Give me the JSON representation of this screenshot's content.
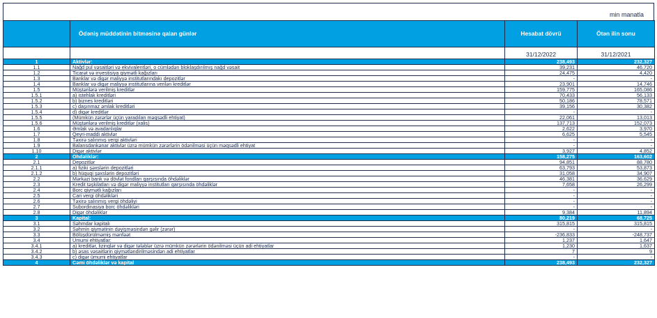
{
  "units": "min manatla",
  "header": {
    "name_col": "Ödəniş müddətinin bitməsinə qalan günlər",
    "current_col": "Hesabat dövrü",
    "previous_col": "Ötən ilin sonu",
    "current_date": "31/12/2022",
    "previous_date": "31/12/2021"
  },
  "rows": [
    {
      "num": "1",
      "name": "Aktivlər:",
      "cur": "238,493",
      "prev": "232,327",
      "section": true
    },
    {
      "num": "1.1",
      "name": "Nağd pul vəsaitləri və  ekvivalentləri, o cümlədən bloklaşdırılmış nağd vəsait",
      "cur": "39,231",
      "prev": "46,720"
    },
    {
      "num": "1.2",
      "name": "Ticarət və investisiya qiymətli kağızları",
      "cur": "24,475",
      "prev": "4,420"
    },
    {
      "num": "1.3",
      "name": "Banklar və digər maliyyə institutlarındakı depozitlər",
      "cur": "-",
      "prev": "-"
    },
    {
      "num": "1.4",
      "name": "Banklar və digər maliyyə institutlarına verilən kreditlər",
      "cur": "23,901",
      "prev": "14,746"
    },
    {
      "num": "1.5",
      "name": "Müştərilərə verilmiş kreditlər",
      "cur": "159,775",
      "prev": "165,086"
    },
    {
      "num": "1.5.1",
      "name": "a) istehlak kreditləri",
      "cur": "70,433",
      "prev": "56,133"
    },
    {
      "num": "1.5.2",
      "name": "b) biznes kreditləri",
      "cur": "50,186",
      "prev": "78,571"
    },
    {
      "num": "1.5.3",
      "name": "c) daşınmaz əmlak kreditləri",
      "cur": "39,156",
      "prev": "30,382"
    },
    {
      "num": "1.5.4",
      "name": "d) digər kreditlər",
      "cur": "-",
      "prev": "-"
    },
    {
      "num": "1.5.5",
      "name": "(Mümkün zərərlər üçün yaradılan məqsədli ehtiyat)",
      "cur": "22,061",
      "prev": "13,013"
    },
    {
      "num": "1.5.6",
      "name": "Müştərilərə verilmiş kreditlər (xalis)",
      "cur": "137,713",
      "prev": "152,073"
    },
    {
      "num": "1.6",
      "name": "Əmlak və avadanlıqlar",
      "cur": "2,622",
      "prev": "3,970"
    },
    {
      "num": "1.7",
      "name": "Qeyri-maddi aktivlər",
      "cur": "6,625",
      "prev": "5,545"
    },
    {
      "num": "1.8",
      "name": "Təxirə salınmış vergi aktivləri",
      "cur": "-",
      "prev": "-"
    },
    {
      "num": "1.9",
      "name": "Balansdankənar aktivlər üzrə mümkün zərərlərin ödənilməsi üçün məqsədli ehtiyat",
      "cur": "-",
      "prev": "-"
    },
    {
      "num": "1.10",
      "name": "Digər aktivlər",
      "cur": "3,927",
      "prev": "4,852"
    },
    {
      "num": "2",
      "name": "Öhdəliklər:",
      "cur": "158,275",
      "prev": "163,602",
      "section": true
    },
    {
      "num": "2.1",
      "name": "Depozitlər",
      "cur": "94,851",
      "prev": "88,780"
    },
    {
      "num": "2.1.1",
      "name": "a) fiziki şəxslərin depozitləri",
      "cur": "63,793",
      "prev": "53,873"
    },
    {
      "num": "2.1.2",
      "name": "b) hüquqi şəxslərin depozitləri",
      "cur": "31,058",
      "prev": "34,907"
    },
    {
      "num": "2.2",
      "name": "Mərkəzi bank və dövlət fondları qarşısında öhdəliklər",
      "cur": "46,381",
      "prev": "36,629"
    },
    {
      "num": "2.3",
      "name": "Kredit təşkilatları və digər maliyyə institutları qarşısında öhdəliklər",
      "cur": "7,658",
      "prev": "26,299"
    },
    {
      "num": "2.4",
      "name": "Borc qiymətli kağızları",
      "cur": "-",
      "prev": "-"
    },
    {
      "num": "2.5",
      "name": "Cari vergi öhdəlikləri",
      "cur": "-",
      "prev": "-"
    },
    {
      "num": "2.6",
      "name": "Təxirə salınmış vergi öhdəliyi",
      "cur": "-",
      "prev": "-"
    },
    {
      "num": "2.7",
      "name": "Subordinasiya borc öhdəlikləri",
      "cur": "-",
      "prev": "-"
    },
    {
      "num": "2.8",
      "name": "Digər öhdəliklər",
      "cur": "9,384",
      "prev": "11,894"
    },
    {
      "num": "3",
      "name": "Kapital:",
      "cur": "80,219",
      "prev": "68,725",
      "section": true
    },
    {
      "num": "3.1",
      "name": "Səhmdar kapitalı",
      "cur": "315,815",
      "prev": "315,815"
    },
    {
      "num": "3.2",
      "name": "Səhmin qiymətinin dəyişməsindən gəlir (zərər)",
      "cur": "-",
      "prev": "-"
    },
    {
      "num": "3.3",
      "name": "Bölüşdürülməmiş mənfəət",
      "cur": "-236,833",
      "prev": "-248,737"
    },
    {
      "num": "3.4",
      "name": "Ümumi ehtiyatlar:",
      "cur": "1,237",
      "prev": "1,647"
    },
    {
      "num": "3.4.1",
      "name": "a) kreditlər, lizinqlər və digər tələblər üzrə mümkün zərərlərin ödənilməsi üçün adi ehtiyatlar",
      "cur": "1,230",
      "prev": "1,637"
    },
    {
      "num": "3.4.2",
      "name": "b) əsas vəsaitlərin qiymətləndirilməsindən adi ehtiyatlar",
      "cur": "7",
      "prev": "9"
    },
    {
      "num": "3.4.3",
      "name": "c) digər ümumi ehtiyatlar",
      "cur": "-",
      "prev": "-"
    },
    {
      "num": "4",
      "name": "Cəmi öhdəliklər və kapital",
      "cur": "238,493",
      "prev": "232,327",
      "section": true
    }
  ],
  "colors": {
    "section_bg": "#00a0e3",
    "text": "#1a2a4a"
  }
}
